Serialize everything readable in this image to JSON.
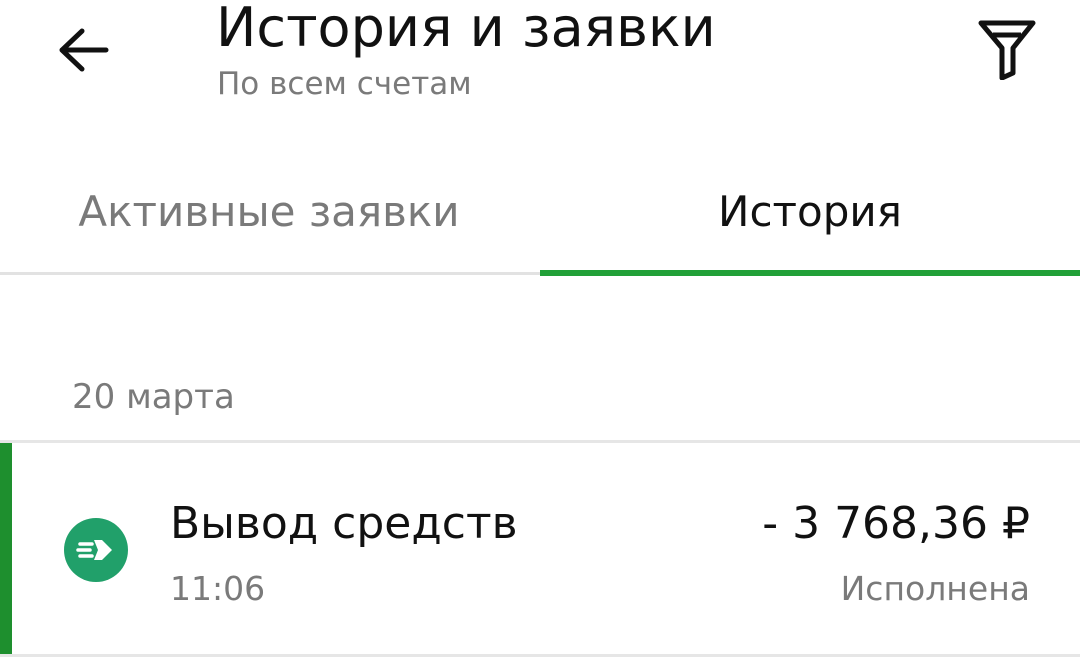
{
  "header": {
    "back_icon": "arrow-left-icon",
    "title": "История и заявки",
    "subtitle": "По всем счетам",
    "filter_icon": "filter-icon"
  },
  "tabs": [
    {
      "label": "Активные заявки",
      "active": false
    },
    {
      "label": "История",
      "active": true
    }
  ],
  "colors": {
    "accent": "#21a038",
    "status_bar": "#1e8f2e",
    "icon_bg": "#21a06a",
    "text_primary": "#111111",
    "text_secondary": "#7a7a7a"
  },
  "history": {
    "groups": [
      {
        "date": "20 марта",
        "operations": [
          {
            "icon": "transfer-out-icon",
            "name": "Вывод средств",
            "time": "11:06",
            "amount": "- 3 768,36 ₽",
            "status": "Исполнена"
          }
        ]
      }
    ]
  }
}
